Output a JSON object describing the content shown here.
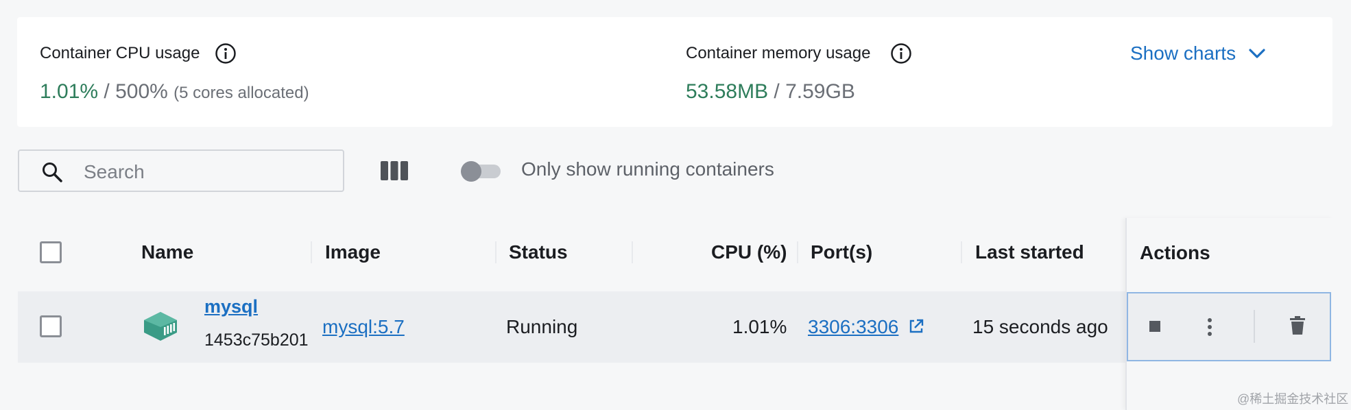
{
  "stats": {
    "cpu": {
      "label": "Container CPU usage",
      "value": "1.01%",
      "separator": " / ",
      "total": "500%",
      "note": "(5 cores allocated)"
    },
    "memory": {
      "label": "Container memory usage",
      "value": "53.58MB",
      "separator": " / ",
      "total": "7.59GB"
    },
    "show_charts_label": "Show charts"
  },
  "toolbar": {
    "search_placeholder": "Search",
    "running_only_label": "Only show running containers",
    "running_only_enabled": false
  },
  "table": {
    "headers": {
      "name": "Name",
      "image": "Image",
      "status": "Status",
      "cpu": "CPU (%)",
      "ports": "Port(s)",
      "last_started": "Last started",
      "actions": "Actions"
    },
    "rows": [
      {
        "name": "mysql",
        "id": "1453c75b201",
        "image": "mysql:5.7",
        "status": "Running",
        "cpu": "1.01%",
        "ports": "3306:3306",
        "last_started": "15 seconds ago"
      }
    ]
  },
  "icons": [
    "info-icon",
    "chevron-down-icon",
    "search-icon",
    "columns-icon",
    "container-icon",
    "external-link-icon",
    "stop-icon",
    "more-vert-icon",
    "trash-icon"
  ],
  "colors": {
    "accent": "#1b6fc2",
    "value_green": "#2e7d5b",
    "container_icon": "#3a9b86"
  },
  "watermark": "@稀土掘金技术社区"
}
